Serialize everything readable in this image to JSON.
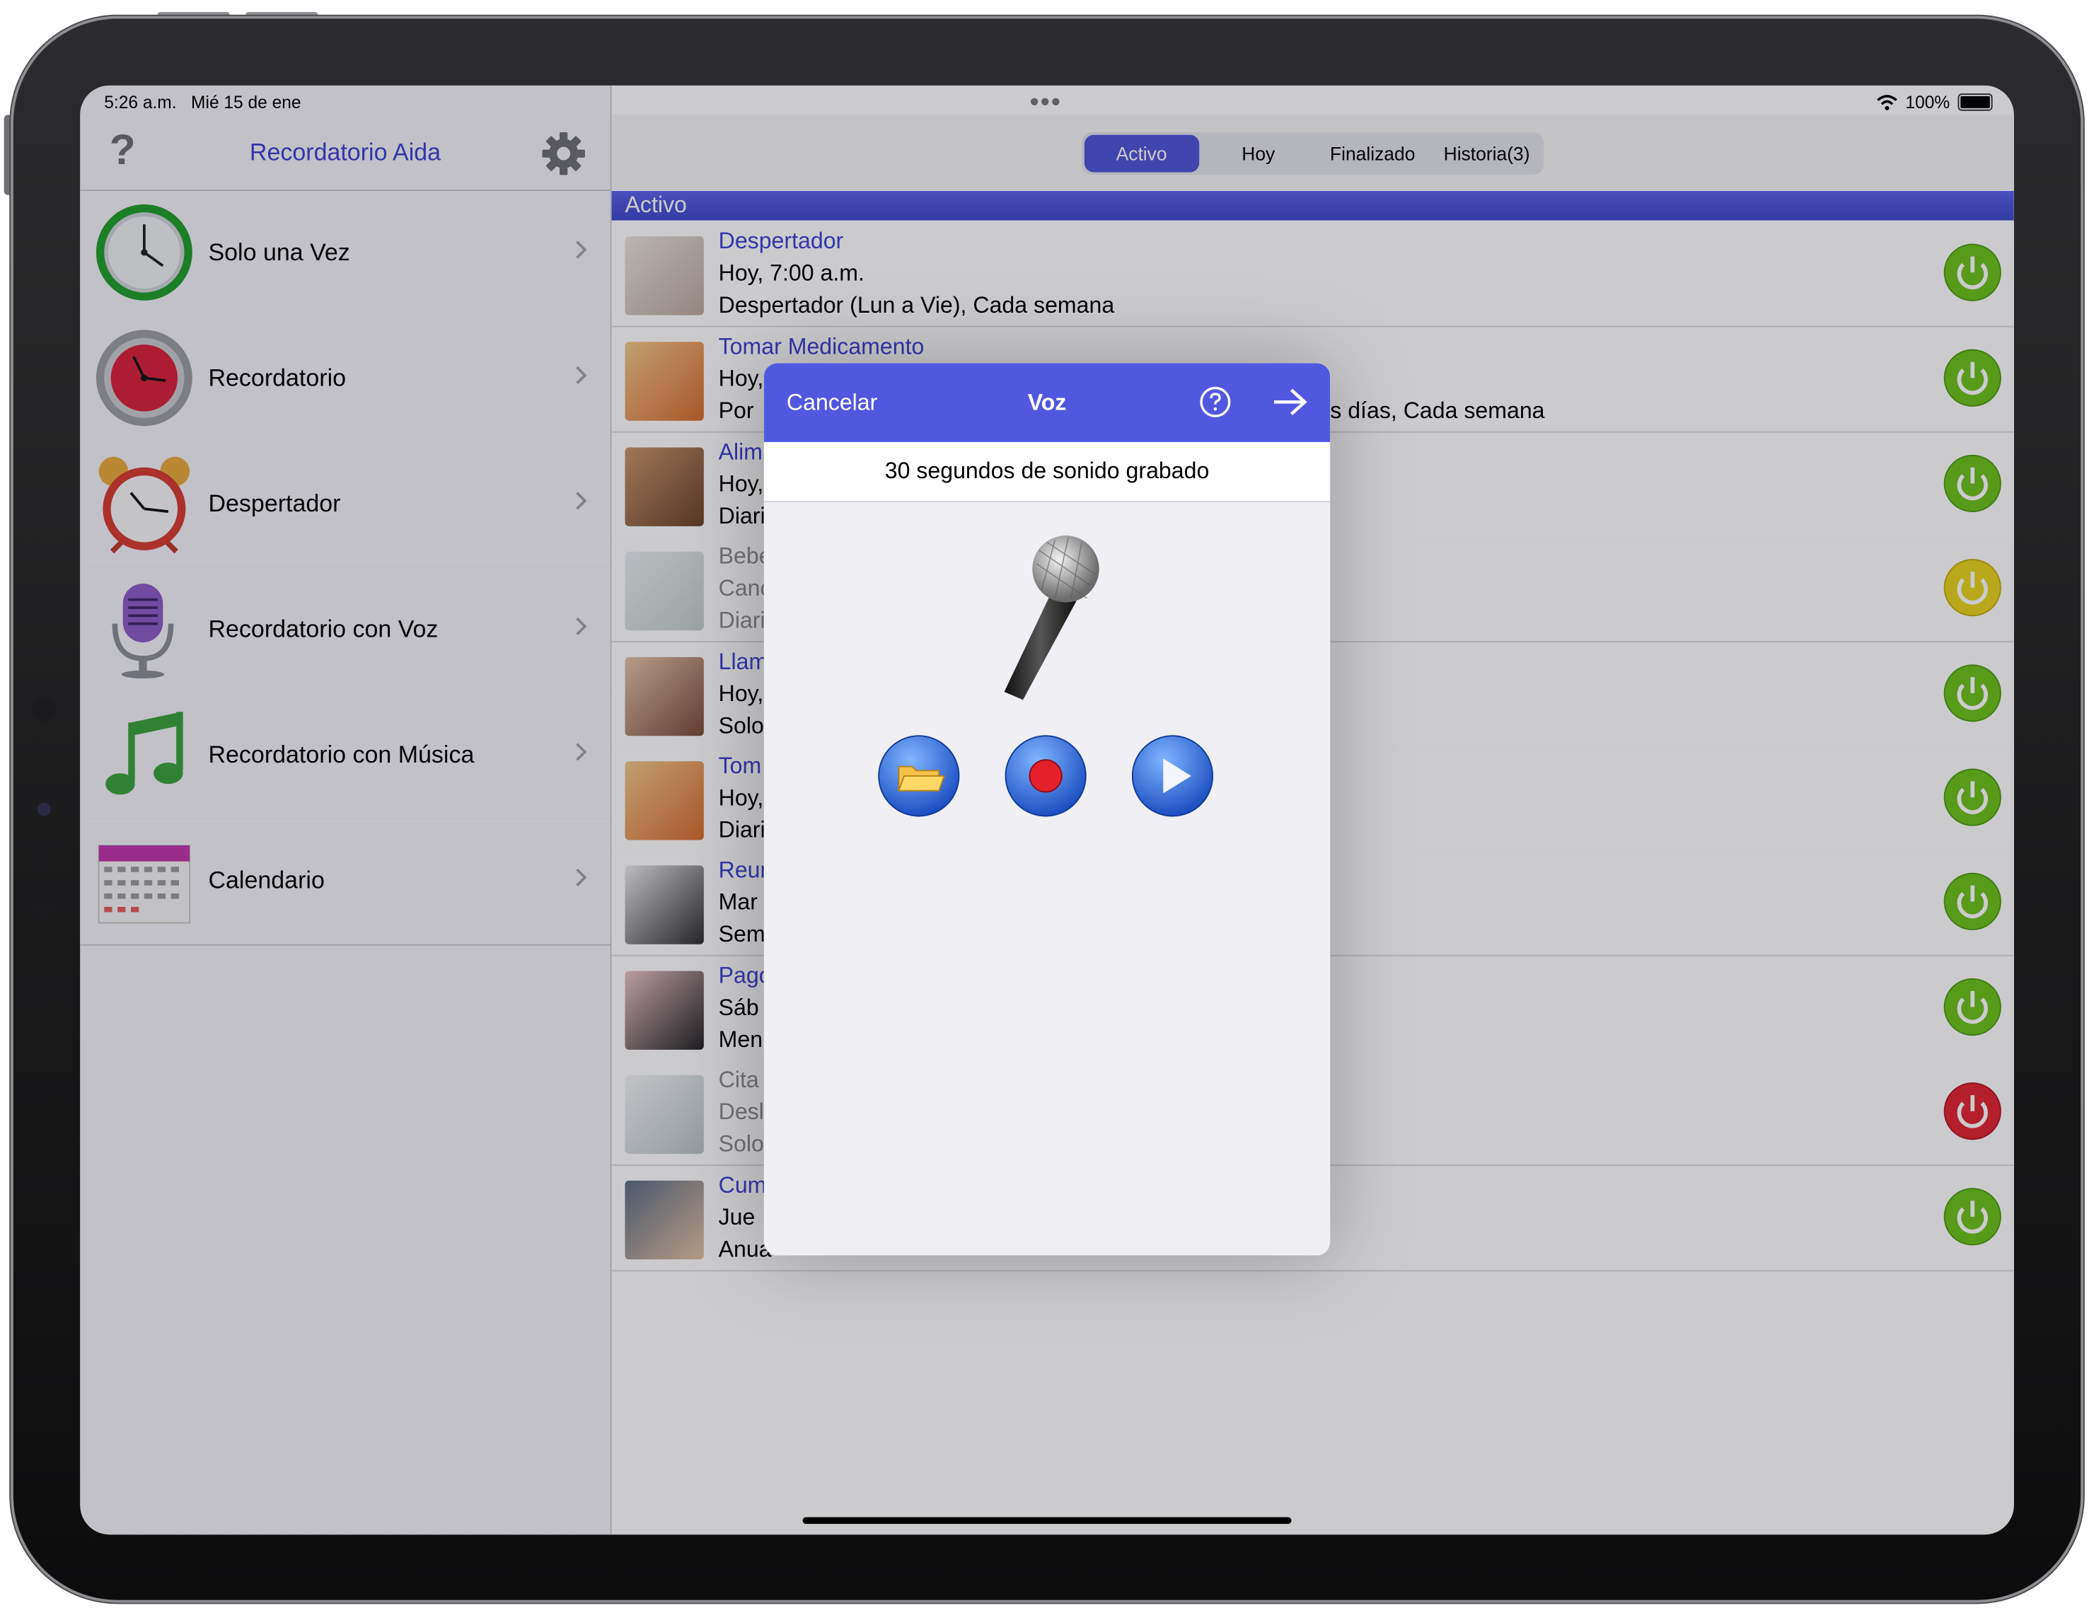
{
  "status": {
    "time": "5:26 a.m.",
    "date": "Mié 15 de ene",
    "battery": "100%"
  },
  "sidebar": {
    "help_glyph": "?",
    "title": "Recordatorio Aida",
    "items": [
      {
        "label": "Solo una Vez",
        "icon": "clock-icon"
      },
      {
        "label": "Recordatorio",
        "icon": "red-clock-icon"
      },
      {
        "label": "Despertador",
        "icon": "alarm-clock-icon"
      },
      {
        "label": "Recordatorio con Voz",
        "icon": "microphone-icon"
      },
      {
        "label": "Recordatorio con Música",
        "icon": "music-note-icon"
      },
      {
        "label": "Calendario",
        "icon": "calendar-icon"
      }
    ]
  },
  "tabs": [
    {
      "label": "Activo",
      "selected": true
    },
    {
      "label": "Hoy",
      "selected": false
    },
    {
      "label": "Finalizado",
      "selected": false
    },
    {
      "label": "Historia(3)",
      "selected": false
    }
  ],
  "section_title": "Activo",
  "reminders": [
    {
      "title": "Despertador",
      "line2": "Hoy, 7:00 a.m.",
      "line3": "Despertador (Lun a Vie), Cada semana",
      "status": "green",
      "dim": false
    },
    {
      "title": "Tomar Medicamento",
      "line2": "Hoy,",
      "line3": "Por",
      "line3_tail": "s días, Cada semana",
      "status": "green",
      "dim": false
    },
    {
      "title": "Alim",
      "line2": "Hoy,",
      "line3": "Diari",
      "status": "green",
      "dim": false
    },
    {
      "title": "Bebe",
      "line2": "Canc",
      "line3": "Diari",
      "status": "yellow",
      "dim": true
    },
    {
      "title": "Llam",
      "line2": "Hoy,",
      "line3": "Solo",
      "status": "green",
      "dim": false
    },
    {
      "title": "Tom",
      "line2": "Hoy,",
      "line3": "Diari",
      "status": "green",
      "dim": false
    },
    {
      "title": "Reun",
      "line2": "Mar",
      "line3": "Sem",
      "status": "green",
      "dim": false
    },
    {
      "title": "Pago",
      "line2": "Sáb",
      "line3": "Men",
      "status": "green",
      "dim": false
    },
    {
      "title": "Cita",
      "line2": "Desl",
      "line3": "Solo",
      "status": "red",
      "dim": true
    },
    {
      "title": "Cum",
      "line2": "Jue",
      "line3": "Anua",
      "status": "green",
      "dim": false
    }
  ],
  "modal": {
    "cancel": "Cancelar",
    "title": "Voz",
    "info": "30 segundos de sonido grabado",
    "buttons": [
      "folder-icon",
      "record-icon",
      "play-icon"
    ]
  },
  "colors": {
    "accent": "#4d55d6",
    "title_blue": "#3b3fd0",
    "green": "#6cc21a",
    "yellow": "#e8d21a",
    "red": "#e0232f"
  }
}
